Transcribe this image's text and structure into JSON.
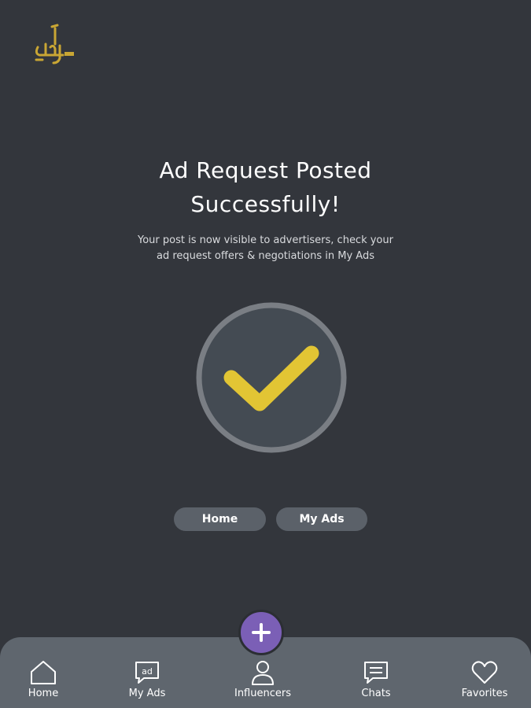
{
  "success": {
    "title_line1": "Ad Request Posted",
    "title_line2": "Successfully!",
    "message_line1": "Your post is now visible to advertisers, check your",
    "message_line2": "ad request offers & negotiations in My Ads"
  },
  "actions": {
    "home_label": "Home",
    "my_ads_label": "My Ads"
  },
  "bottom_nav": {
    "items": [
      {
        "label": "Home",
        "icon": "home-icon"
      },
      {
        "label": "My Ads",
        "icon": "ad-chat-icon"
      },
      {
        "label": "Influencers",
        "icon": "person-icon"
      },
      {
        "label": "Chats",
        "icon": "chat-icon"
      },
      {
        "label": "Favorites",
        "icon": "heart-icon"
      }
    ],
    "fab_icon": "plus-icon"
  },
  "colors": {
    "background": "#33363c",
    "accent_yellow": "#e2c534",
    "fab_purple": "#7b5fb6",
    "nav_bar": "#5f666e"
  }
}
